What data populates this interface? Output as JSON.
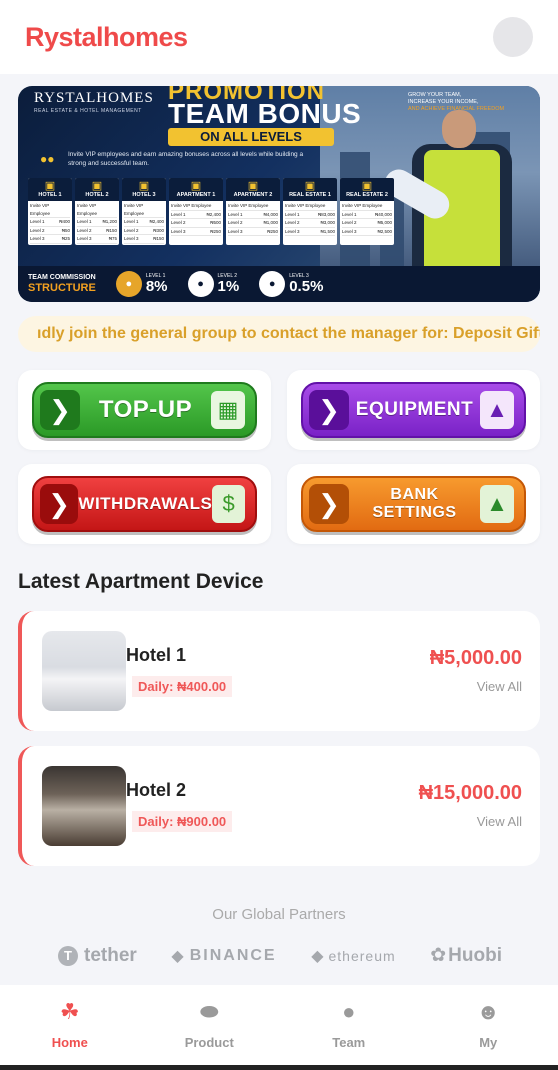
{
  "app": {
    "title": "Rystalhomes"
  },
  "banner": {
    "logo": "RYSTALHOMES",
    "logo_sub": "REAL ESTATE & HOTEL MANAGEMENT",
    "promo": "PROMOTION",
    "title": "TEAM BONUS",
    "levels": "ON ALL LEVELS",
    "invite": "Invite VIP employees and earn amazing bonuses across all levels while building a strong and successful team.",
    "columns": [
      {
        "name": "HOTEL 1",
        "rows": [
          [
            "Invite VIP Employee",
            ""
          ],
          [
            "Level 1",
            "₦400"
          ],
          [
            "Level 2",
            "₦50"
          ],
          [
            "Level 3",
            "₦25"
          ]
        ]
      },
      {
        "name": "HOTEL 2",
        "rows": [
          [
            "Invite VIP Employee",
            ""
          ],
          [
            "Level 1",
            "₦1,200"
          ],
          [
            "Level 2",
            "₦150"
          ],
          [
            "Level 3",
            "₦75"
          ]
        ]
      },
      {
        "name": "HOTEL 3",
        "rows": [
          [
            "Invite VIP Employee",
            ""
          ],
          [
            "Level 1",
            "₦2,400"
          ],
          [
            "Level 2",
            "₦300"
          ],
          [
            "Level 3",
            "₦150"
          ]
        ]
      },
      {
        "name": "APARTMENT 1",
        "rows": [
          [
            "Invite VIP Employee",
            ""
          ],
          [
            "Level 1",
            "₦2,400"
          ],
          [
            "Level 2",
            "₦500"
          ],
          [
            "Level 3",
            "₦250"
          ]
        ]
      },
      {
        "name": "APARTMENT 2",
        "rows": [
          [
            "Invite VIP Employee",
            ""
          ],
          [
            "Level 1",
            "₦4,000"
          ],
          [
            "Level 2",
            "₦1,000"
          ],
          [
            "Level 3",
            "₦250"
          ]
        ]
      },
      {
        "name": "REAL ESTATE 1",
        "rows": [
          [
            "Invite VIP Employee",
            ""
          ],
          [
            "Level 1",
            "₦83,000"
          ],
          [
            "Level 2",
            "₦3,000"
          ],
          [
            "Level 3",
            "₦1,500"
          ]
        ]
      },
      {
        "name": "REAL ESTATE 2",
        "rows": [
          [
            "Invite VIP Employee",
            ""
          ],
          [
            "Level 1",
            "₦40,000"
          ],
          [
            "Level 2",
            "₦5,000"
          ],
          [
            "Level 3",
            "₦2,500"
          ]
        ]
      }
    ],
    "commission_label": "TEAM COMMISSION",
    "commission_sub": "STRUCTURE",
    "level1_label": "LEVEL 1",
    "level1_pct": "8%",
    "level2_label": "LEVEL 2",
    "level2_pct": "1%",
    "level3_label": "LEVEL 3",
    "level3_pct": "0.5%",
    "grow_line1": "GROW YOUR TEAM,",
    "grow_line2": "INCREASE YOUR INCOME,",
    "grow_line3": "AND ACHIEVE FINANCIAL FREEDOM"
  },
  "marquee": {
    "text": "ıdly join the general group to contact the manager for: Deposit Gift"
  },
  "actions": {
    "topup": "TOP-UP",
    "equipment": "EQUIPMENT",
    "withdrawals": "WITHDRAWALS",
    "bank": "BANK SETTINGS"
  },
  "section": {
    "title": "Latest Apartment Device"
  },
  "devices": [
    {
      "name": "Hotel 1",
      "daily": "Daily: ₦400.00",
      "price": "₦5,000.00",
      "view": "View All"
    },
    {
      "name": "Hotel 2",
      "daily": "Daily: ₦900.00",
      "price": "₦15,000.00",
      "view": "View All"
    }
  ],
  "partners": {
    "title": "Our Global Partners",
    "items": [
      "tether",
      "BINANCE",
      "ethereum",
      "Huobi"
    ]
  },
  "nav": {
    "items": [
      {
        "label": "Home",
        "icon": "home-icon"
      },
      {
        "label": "Product",
        "icon": "product-icon"
      },
      {
        "label": "Team",
        "icon": "team-icon"
      },
      {
        "label": "My",
        "icon": "user-icon"
      }
    ]
  },
  "colors": {
    "accent": "#ef4a4a",
    "marquee_text": "#d9a02a"
  }
}
